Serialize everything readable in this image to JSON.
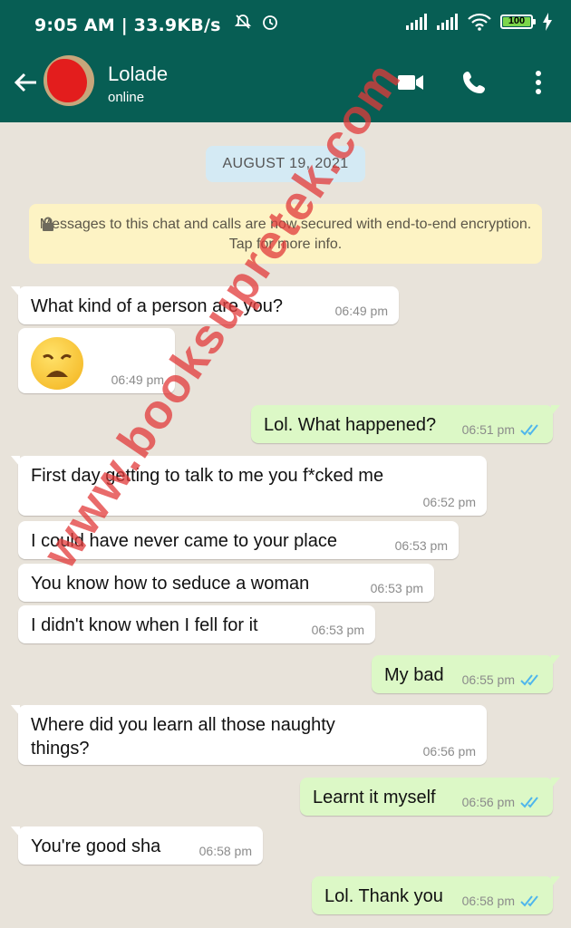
{
  "status_bar": {
    "time_info": "9:05 AM | 33.9KB/s",
    "battery": "100"
  },
  "header": {
    "contact_name": "Lolade",
    "contact_status": "online",
    "icons": [
      "back-arrow-icon",
      "avatar",
      "video-call-icon",
      "voice-call-icon",
      "more-options-icon"
    ]
  },
  "chat": {
    "date": "AUGUST 19, 2021",
    "encryption_notice": "Messages to this chat and calls are now secured with end-to-end encryption. Tap for more info.",
    "messages": [
      {
        "dir": "in",
        "text": "What kind of a person are you?",
        "time": "06:49 pm"
      },
      {
        "dir": "in",
        "text": "",
        "emoji": "weary-face",
        "time": "06:49 pm"
      },
      {
        "dir": "out",
        "text": "Lol. What happened?",
        "time": "06:51 pm",
        "ticks": "read"
      },
      {
        "dir": "in",
        "text": "First day getting to talk to me you f*cked me",
        "time": "06:52 pm"
      },
      {
        "dir": "in",
        "text": "I could have never came to your place",
        "time": "06:53 pm"
      },
      {
        "dir": "in",
        "text": "You know how to seduce a woman",
        "time": "06:53 pm"
      },
      {
        "dir": "in",
        "text": "I didn't know when I fell for it",
        "time": "06:53 pm"
      },
      {
        "dir": "out",
        "text": "My bad",
        "time": "06:55 pm",
        "ticks": "read"
      },
      {
        "dir": "in",
        "text": "Where did you learn all those naughty things?",
        "time": "06:56 pm"
      },
      {
        "dir": "out",
        "text": "Learnt it myself",
        "time": "06:56 pm",
        "ticks": "read"
      },
      {
        "dir": "in",
        "text": "You're good sha",
        "time": "06:58 pm"
      },
      {
        "dir": "out",
        "text": "Lol. Thank you",
        "time": "06:58 pm",
        "ticks": "read"
      }
    ]
  },
  "watermark": "www.booksupretek.com",
  "colors": {
    "header": "#075e54",
    "outgoing": "#dcf8c6",
    "incoming": "#ffffff",
    "read_ticks": "#4fb6ec",
    "chat_bg": "#e8e3da"
  }
}
